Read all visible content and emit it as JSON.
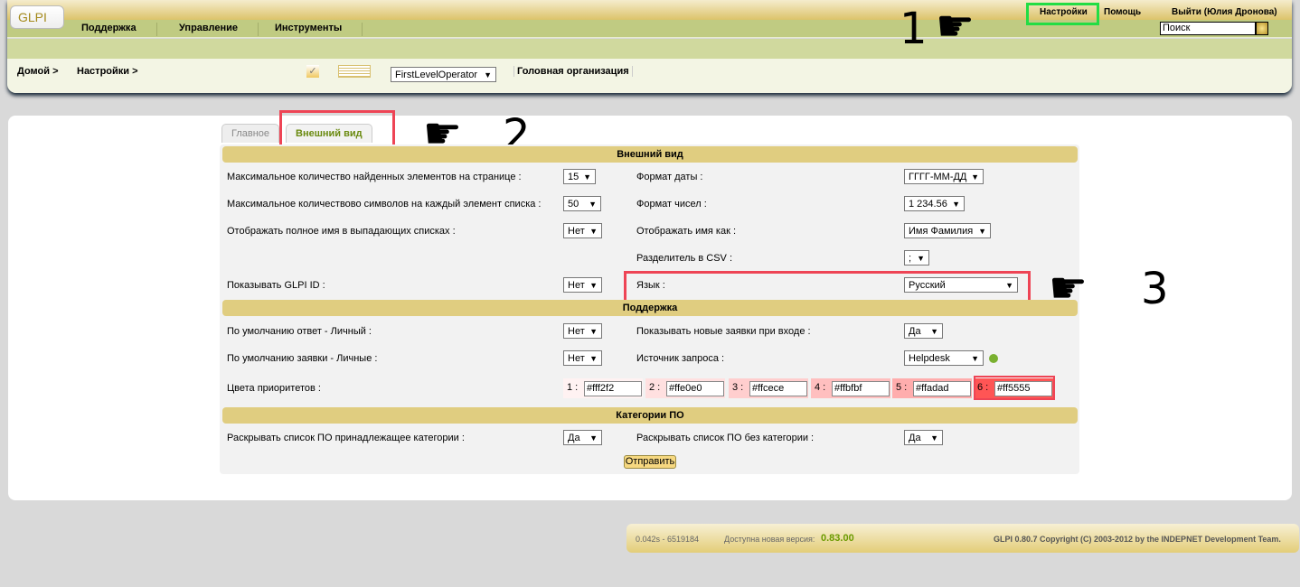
{
  "header": {
    "logo": "GLPI",
    "menu": [
      "Поддержка",
      "Управление",
      "Инструменты"
    ],
    "top_links": {
      "settings": "Настройки",
      "help": "Помощь",
      "logout": "Выйти (Юлия Дронова)"
    },
    "search_placeholder": "Поиск",
    "breadcrumb": [
      "Домой >",
      "Настройки >"
    ],
    "profile": "FirstLevelOperator",
    "entity": "Головная организация"
  },
  "tabs": [
    {
      "label": "Главное",
      "active": false
    },
    {
      "label": "Внешний вид",
      "active": true
    }
  ],
  "sections": {
    "appearance": "Внешний вид",
    "support": "Поддержка",
    "software": "Категории ПО"
  },
  "fields": {
    "max_items": {
      "label": "Максимальное количество найденных элементов на странице :",
      "value": "15"
    },
    "max_chars": {
      "label": "Максимальное количествово символов на каждый элемент списка :",
      "value": "50"
    },
    "full_name": {
      "label": "Отображать полное имя в выпадающих списках :",
      "value": "Нет"
    },
    "show_id": {
      "label": "Показывать GLPI ID :",
      "value": "Нет"
    },
    "date_format": {
      "label": "Формат даты :",
      "value": "ГГГГ-ММ-ДД"
    },
    "number_format": {
      "label": "Формат чисел :",
      "value": "1 234.56"
    },
    "name_display": {
      "label": "Отображать имя как :",
      "value": "Имя Фамилия"
    },
    "csv_sep": {
      "label": "Разделитель в CSV :",
      "value": ";"
    },
    "language": {
      "label": "Язык :",
      "value": "Русский"
    },
    "default_reply": {
      "label": "По умолчанию ответ - Личный :",
      "value": "Нет"
    },
    "default_tickets": {
      "label": "По умолчанию заявки - Личные :",
      "value": "Нет"
    },
    "show_new": {
      "label": "Показывать новые заявки при входе :",
      "value": "Да"
    },
    "source": {
      "label": "Источник запроса :",
      "value": "Helpdesk"
    },
    "priority_label": "Цвета приоритетов :",
    "priorities": [
      {
        "n": "1 :",
        "v": "#fff2f2"
      },
      {
        "n": "2 :",
        "v": "#ffe0e0"
      },
      {
        "n": "3 :",
        "v": "#ffcece"
      },
      {
        "n": "4 :",
        "v": "#ffbfbf"
      },
      {
        "n": "5 :",
        "v": "#ffadad"
      },
      {
        "n": "6 :",
        "v": "#ff5555"
      }
    ],
    "expand_cat": {
      "label": "Раскрывать список ПО принадлежащее категории :",
      "value": "Да"
    },
    "expand_nocat": {
      "label": "Раскрывать список ПО без категории :",
      "value": "Да"
    }
  },
  "submit": "Отправить",
  "footer": {
    "timing": "0.042s - 6519184",
    "new_version_label": "Доступна новая версия:",
    "new_version": "0.83.00",
    "copyright": "GLPI 0.80.7 Copyright (C) 2003-2012 by the INDEPNET Development Team."
  },
  "annotations": [
    "1",
    "2",
    "3"
  ],
  "colors": {
    "highlight_green": "#22dd44",
    "highlight_red": "#ee4455",
    "section": "#e0cd80"
  }
}
